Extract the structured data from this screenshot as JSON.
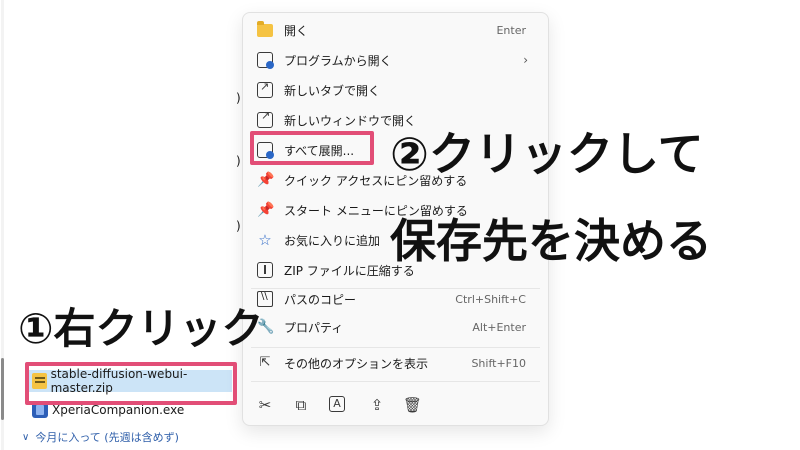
{
  "explorer": {
    "fragments": [
      ")",
      ")",
      ")"
    ],
    "files": [
      {
        "name": "stable-diffusion-webui-master.zip",
        "icon": "zip-folder-icon",
        "selected": true
      },
      {
        "name": "XperiaCompanion.exe",
        "icon": "exe-app-icon",
        "selected": false
      }
    ],
    "group_header": "今月に入って (先週は含めず)"
  },
  "context_menu": {
    "items": [
      {
        "label": "開く",
        "shortcut": "Enter",
        "icon": "folder-icon"
      },
      {
        "label": "プログラムから開く",
        "shortcut": "",
        "icon": "open-with-icon",
        "submenu": true
      },
      {
        "label": "新しいタブで開く",
        "shortcut": "",
        "icon": "new-tab-icon"
      },
      {
        "label": "新しいウィンドウで開く",
        "shortcut": "",
        "icon": "new-window-icon"
      },
      {
        "label": "すべて展開...",
        "shortcut": "",
        "icon": "extract-all-icon"
      },
      {
        "label": "クイック アクセスにピン留めする",
        "shortcut": "",
        "icon": "pin-icon"
      },
      {
        "label": "スタート メニューにピン留めする",
        "shortcut": "",
        "icon": "pin-start-icon"
      },
      {
        "label": "お気に入りに追加",
        "shortcut": "",
        "icon": "star-icon"
      },
      {
        "label": "ZIP ファイルに圧縮する",
        "shortcut": "",
        "icon": "zip-compress-icon"
      },
      {
        "label": "パスのコピー",
        "shortcut": "Ctrl+Shift+C",
        "icon": "copy-path-icon"
      },
      {
        "label": "プロパティ",
        "shortcut": "Alt+Enter",
        "icon": "properties-icon"
      },
      {
        "label": "その他のオプションを表示",
        "shortcut": "Shift+F10",
        "icon": "more-options-icon"
      }
    ],
    "bottom_actions": [
      {
        "icon": "cut-icon",
        "glyph": "✂"
      },
      {
        "icon": "copy-icon",
        "glyph": "⧉"
      },
      {
        "icon": "rename-icon",
        "glyph": "A"
      },
      {
        "icon": "share-icon",
        "glyph": "⇪"
      },
      {
        "icon": "delete-icon",
        "glyph": "🗑"
      }
    ]
  },
  "annotations": {
    "step2_line1": "②クリックして",
    "step2_line2": "保存先を決める",
    "step1": "①右クリック",
    "highlight_color": "#e24e77"
  }
}
